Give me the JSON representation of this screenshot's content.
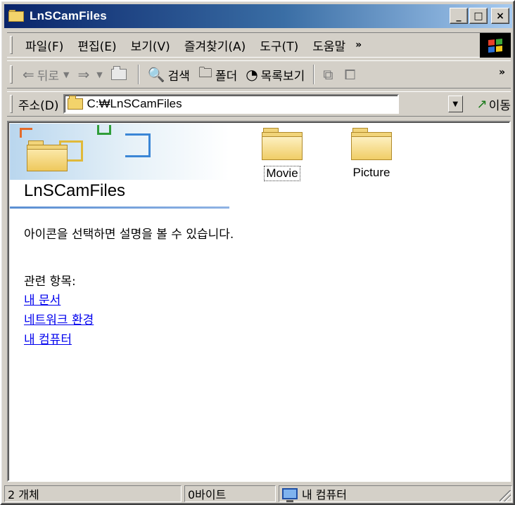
{
  "window": {
    "title": "LnSCamFiles",
    "minimize_label": "_",
    "maximize_label": "□",
    "close_label": "×"
  },
  "menu": {
    "items": [
      "파일(F)",
      "편집(E)",
      "보기(V)",
      "즐겨찾기(A)",
      "도구(T)",
      "도움말"
    ],
    "more": "»"
  },
  "toolbar": {
    "back_label": "뒤로",
    "search_label": "검색",
    "folders_label": "폴더",
    "history_label": "목록보기",
    "more": "»",
    "icons": [
      "back-arrow-icon",
      "forward-arrow-icon",
      "up-folder-icon",
      "search-icon",
      "folders-icon",
      "history-icon",
      "move-to-icon",
      "copy-to-icon"
    ]
  },
  "address": {
    "label": "주소(D)",
    "value": "C:₩LnSCamFiles",
    "go_label": "이동"
  },
  "panel": {
    "title": "LnSCamFiles",
    "description": "아이콘을 선택하면 설명을 볼 수 있습니다.",
    "related_label": "관련 항목:",
    "links": [
      "내 문서",
      "네트워크 환경",
      "내 컴퓨터"
    ]
  },
  "files": [
    {
      "name": "Movie",
      "focused": true
    },
    {
      "name": "Picture",
      "focused": false
    }
  ],
  "status": {
    "count": "2 개체",
    "size": "0바이트",
    "location": "내 컴퓨터"
  },
  "colors": {
    "title_start": "#0a246a",
    "title_end": "#a6caf0",
    "folder": "#f1d47a",
    "link": "#0000ee",
    "chrome": "#d4d0c8"
  }
}
